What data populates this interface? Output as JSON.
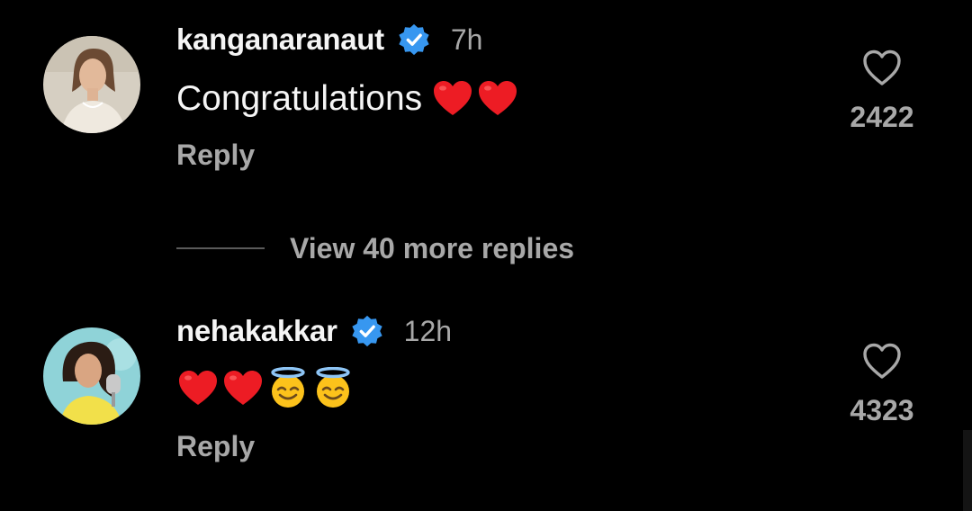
{
  "comments": [
    {
      "username": "kanganaranaut",
      "verified": true,
      "timestamp": "7h",
      "text": "Congratulations",
      "emojis": [
        "red-heart",
        "red-heart"
      ],
      "reply_label": "Reply",
      "like_count": "2422"
    },
    {
      "username": "nehakakkar",
      "verified": true,
      "timestamp": "12h",
      "text": "",
      "emojis": [
        "red-heart",
        "red-heart",
        "smiling-face-with-halo",
        "smiling-face-with-halo"
      ],
      "reply_label": "Reply",
      "like_count": "4323"
    }
  ],
  "view_replies": {
    "label": "View 40 more replies"
  },
  "colors": {
    "background": "#000000",
    "primary_text": "#f5f5f5",
    "secondary_text": "#a8a8a8",
    "verified_blue": "#3797f0",
    "heart_red": "#ed1c24"
  }
}
